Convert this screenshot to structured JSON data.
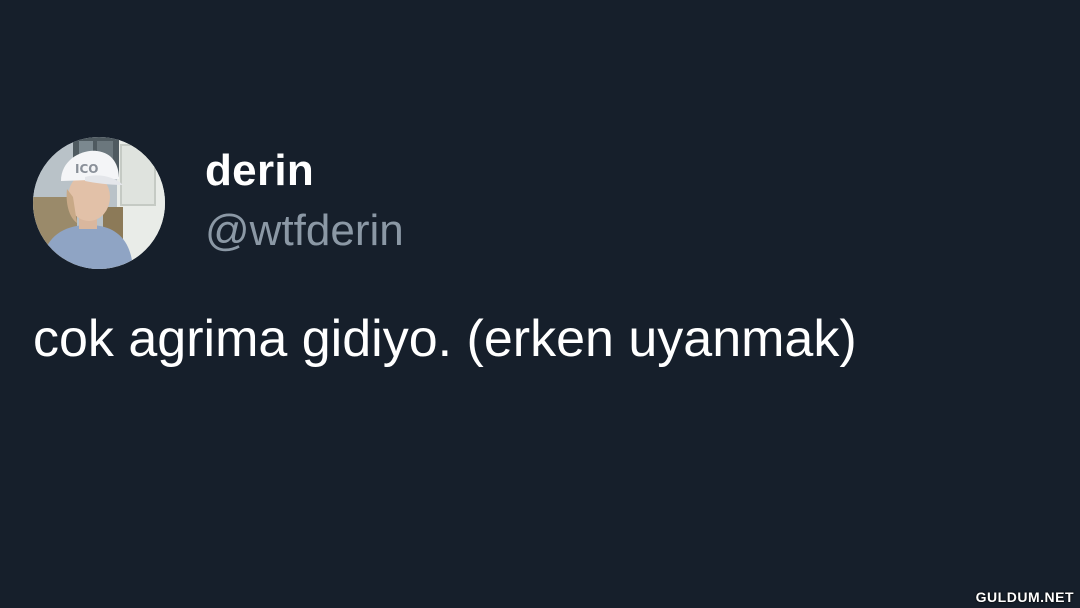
{
  "tweet": {
    "display_name": "derin",
    "handle": "@wtfderin",
    "text": "cok agrima gidiyo. (erken uyanmak)"
  },
  "watermark": "GULDUM.NET",
  "colors": {
    "background": "#161f2b",
    "name": "#ffffff",
    "handle": "#8b98a5",
    "text": "#ffffff"
  },
  "icons": {
    "avatar": "profile-photo"
  }
}
